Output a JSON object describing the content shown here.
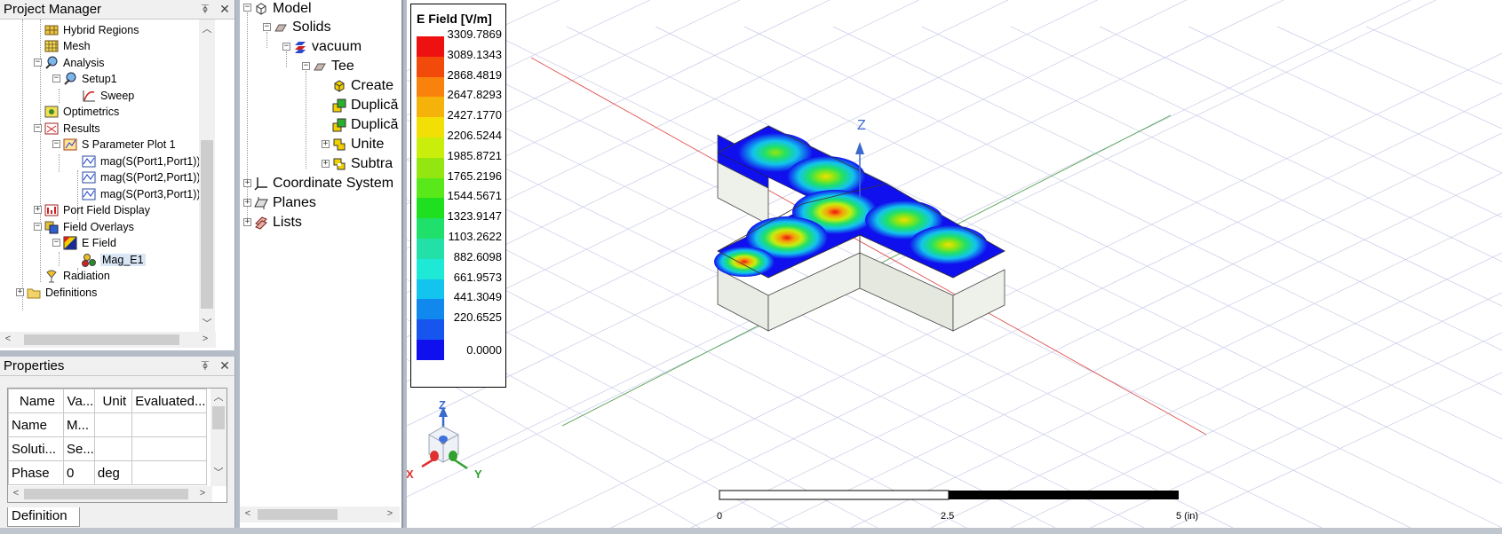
{
  "project_manager": {
    "title": "Project Manager",
    "pin": "⍕",
    "close": "✕",
    "tree": [
      {
        "label": "Hybrid Regions",
        "depth": 2
      },
      {
        "label": "Mesh",
        "depth": 2
      },
      {
        "label": "Analysis",
        "depth": 2
      },
      {
        "label": "Setup1",
        "depth": 3
      },
      {
        "label": "Sweep",
        "depth": 4
      },
      {
        "label": "Optimetrics",
        "depth": 2
      },
      {
        "label": "Results",
        "depth": 2
      },
      {
        "label": "S Parameter Plot 1",
        "depth": 3
      },
      {
        "label": "mag(S(Port1,Port1))",
        "depth": 4
      },
      {
        "label": "mag(S(Port2,Port1))",
        "depth": 4
      },
      {
        "label": "mag(S(Port3,Port1))",
        "depth": 4
      },
      {
        "label": "Port Field Display",
        "depth": 2
      },
      {
        "label": "Field Overlays",
        "depth": 2
      },
      {
        "label": "E Field",
        "depth": 3
      },
      {
        "label": "Mag_E1",
        "depth": 4
      },
      {
        "label": "Radiation",
        "depth": 2
      },
      {
        "label": "Definitions",
        "depth": 1
      }
    ]
  },
  "properties": {
    "title": "Properties",
    "columns": [
      "Name",
      "Va...",
      "Unit",
      "Evaluated..."
    ],
    "rows": [
      [
        "Name",
        "M...",
        "",
        ""
      ],
      [
        "Soluti...",
        "Se...",
        "",
        ""
      ],
      [
        "Phase",
        "0",
        "deg",
        ""
      ]
    ],
    "tab": "Definition"
  },
  "model_tree": [
    {
      "label": "Model",
      "depth": 0
    },
    {
      "label": "Solids",
      "depth": 1
    },
    {
      "label": "vacuum",
      "depth": 2
    },
    {
      "label": "Tee",
      "depth": 3
    },
    {
      "label": "Create",
      "depth": 4
    },
    {
      "label": "Duplică",
      "depth": 4
    },
    {
      "label": "Duplică",
      "depth": 4
    },
    {
      "label": "Unite",
      "depth": 4
    },
    {
      "label": "Subtra",
      "depth": 4
    },
    {
      "label": "Coordinate System",
      "depth": 0
    },
    {
      "label": "Planes",
      "depth": 0
    },
    {
      "label": "Lists",
      "depth": 0
    }
  ],
  "legend": {
    "title": "E Field [V/m]",
    "values": [
      "3309.7869",
      "3089.1343",
      "2868.4819",
      "2647.8293",
      "2427.1770",
      "2206.5244",
      "1985.8721",
      "1765.2196",
      "1544.5671",
      "1323.9147",
      "1103.2622",
      "882.6098",
      "661.9573",
      "441.3049",
      "220.6525",
      "0.0000"
    ],
    "colors": [
      "#ee1111",
      "#f24a0a",
      "#f9820c",
      "#f5b20a",
      "#f2df05",
      "#c9ee0c",
      "#93e60f",
      "#59e81a",
      "#1fe01f",
      "#1fe06a",
      "#22e0a8",
      "#1ee8d6",
      "#12c4ee",
      "#1188ee",
      "#1655ee",
      "#1010ee"
    ]
  },
  "axis_labels": {
    "z": "Z",
    "x": "X",
    "y": "Y"
  },
  "scale": {
    "labels": [
      "0",
      "2.5",
      "5 (in)"
    ]
  }
}
